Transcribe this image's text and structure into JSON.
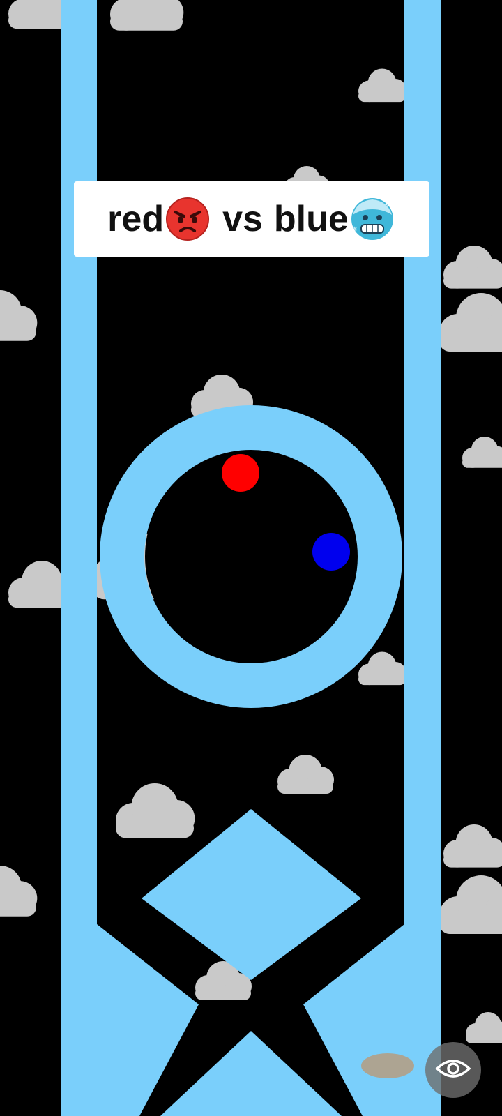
{
  "caption": {
    "text_red": "red",
    "emoji_red": "angry-face",
    "text_vs": "vs",
    "text_blue": "blue",
    "emoji_blue": "cold-face"
  },
  "game": {
    "balls": [
      {
        "name": "red-ball",
        "color": "#FF0000"
      },
      {
        "name": "blue-ball",
        "color": "#0000EE"
      }
    ],
    "colors": {
      "background": "#000000",
      "track": "#7ACFFB",
      "cloud": "#C8C8C8"
    }
  },
  "controls": {
    "eye_icon": "eye-icon"
  }
}
